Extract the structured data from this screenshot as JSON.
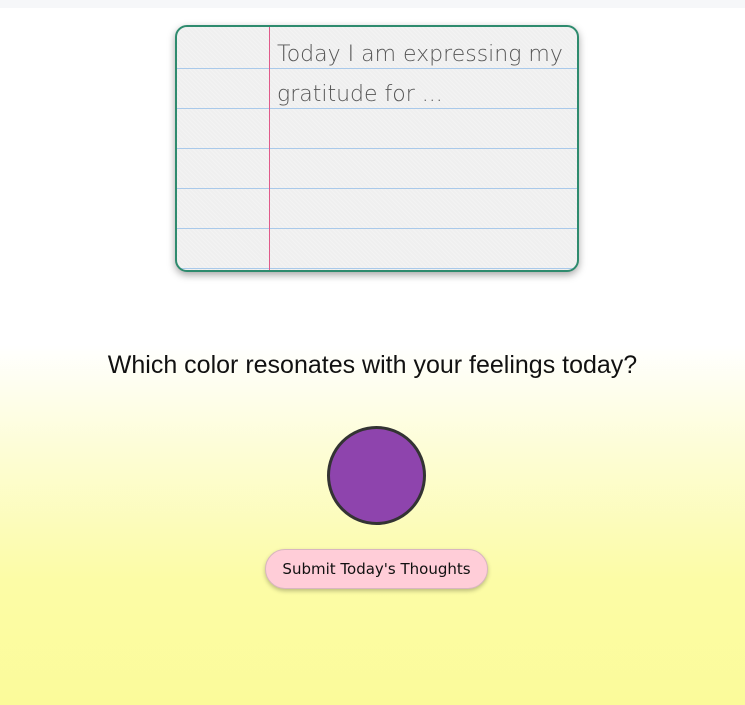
{
  "gratitude": {
    "placeholder": "Today I am expressing my gratitude for ..."
  },
  "mood": {
    "question": "Which color resonates with your feelings today?",
    "selected_color": "#8e44ad"
  },
  "actions": {
    "submit_label": "Submit Today's Thoughts",
    "submit_color": "#ffcdd8"
  }
}
